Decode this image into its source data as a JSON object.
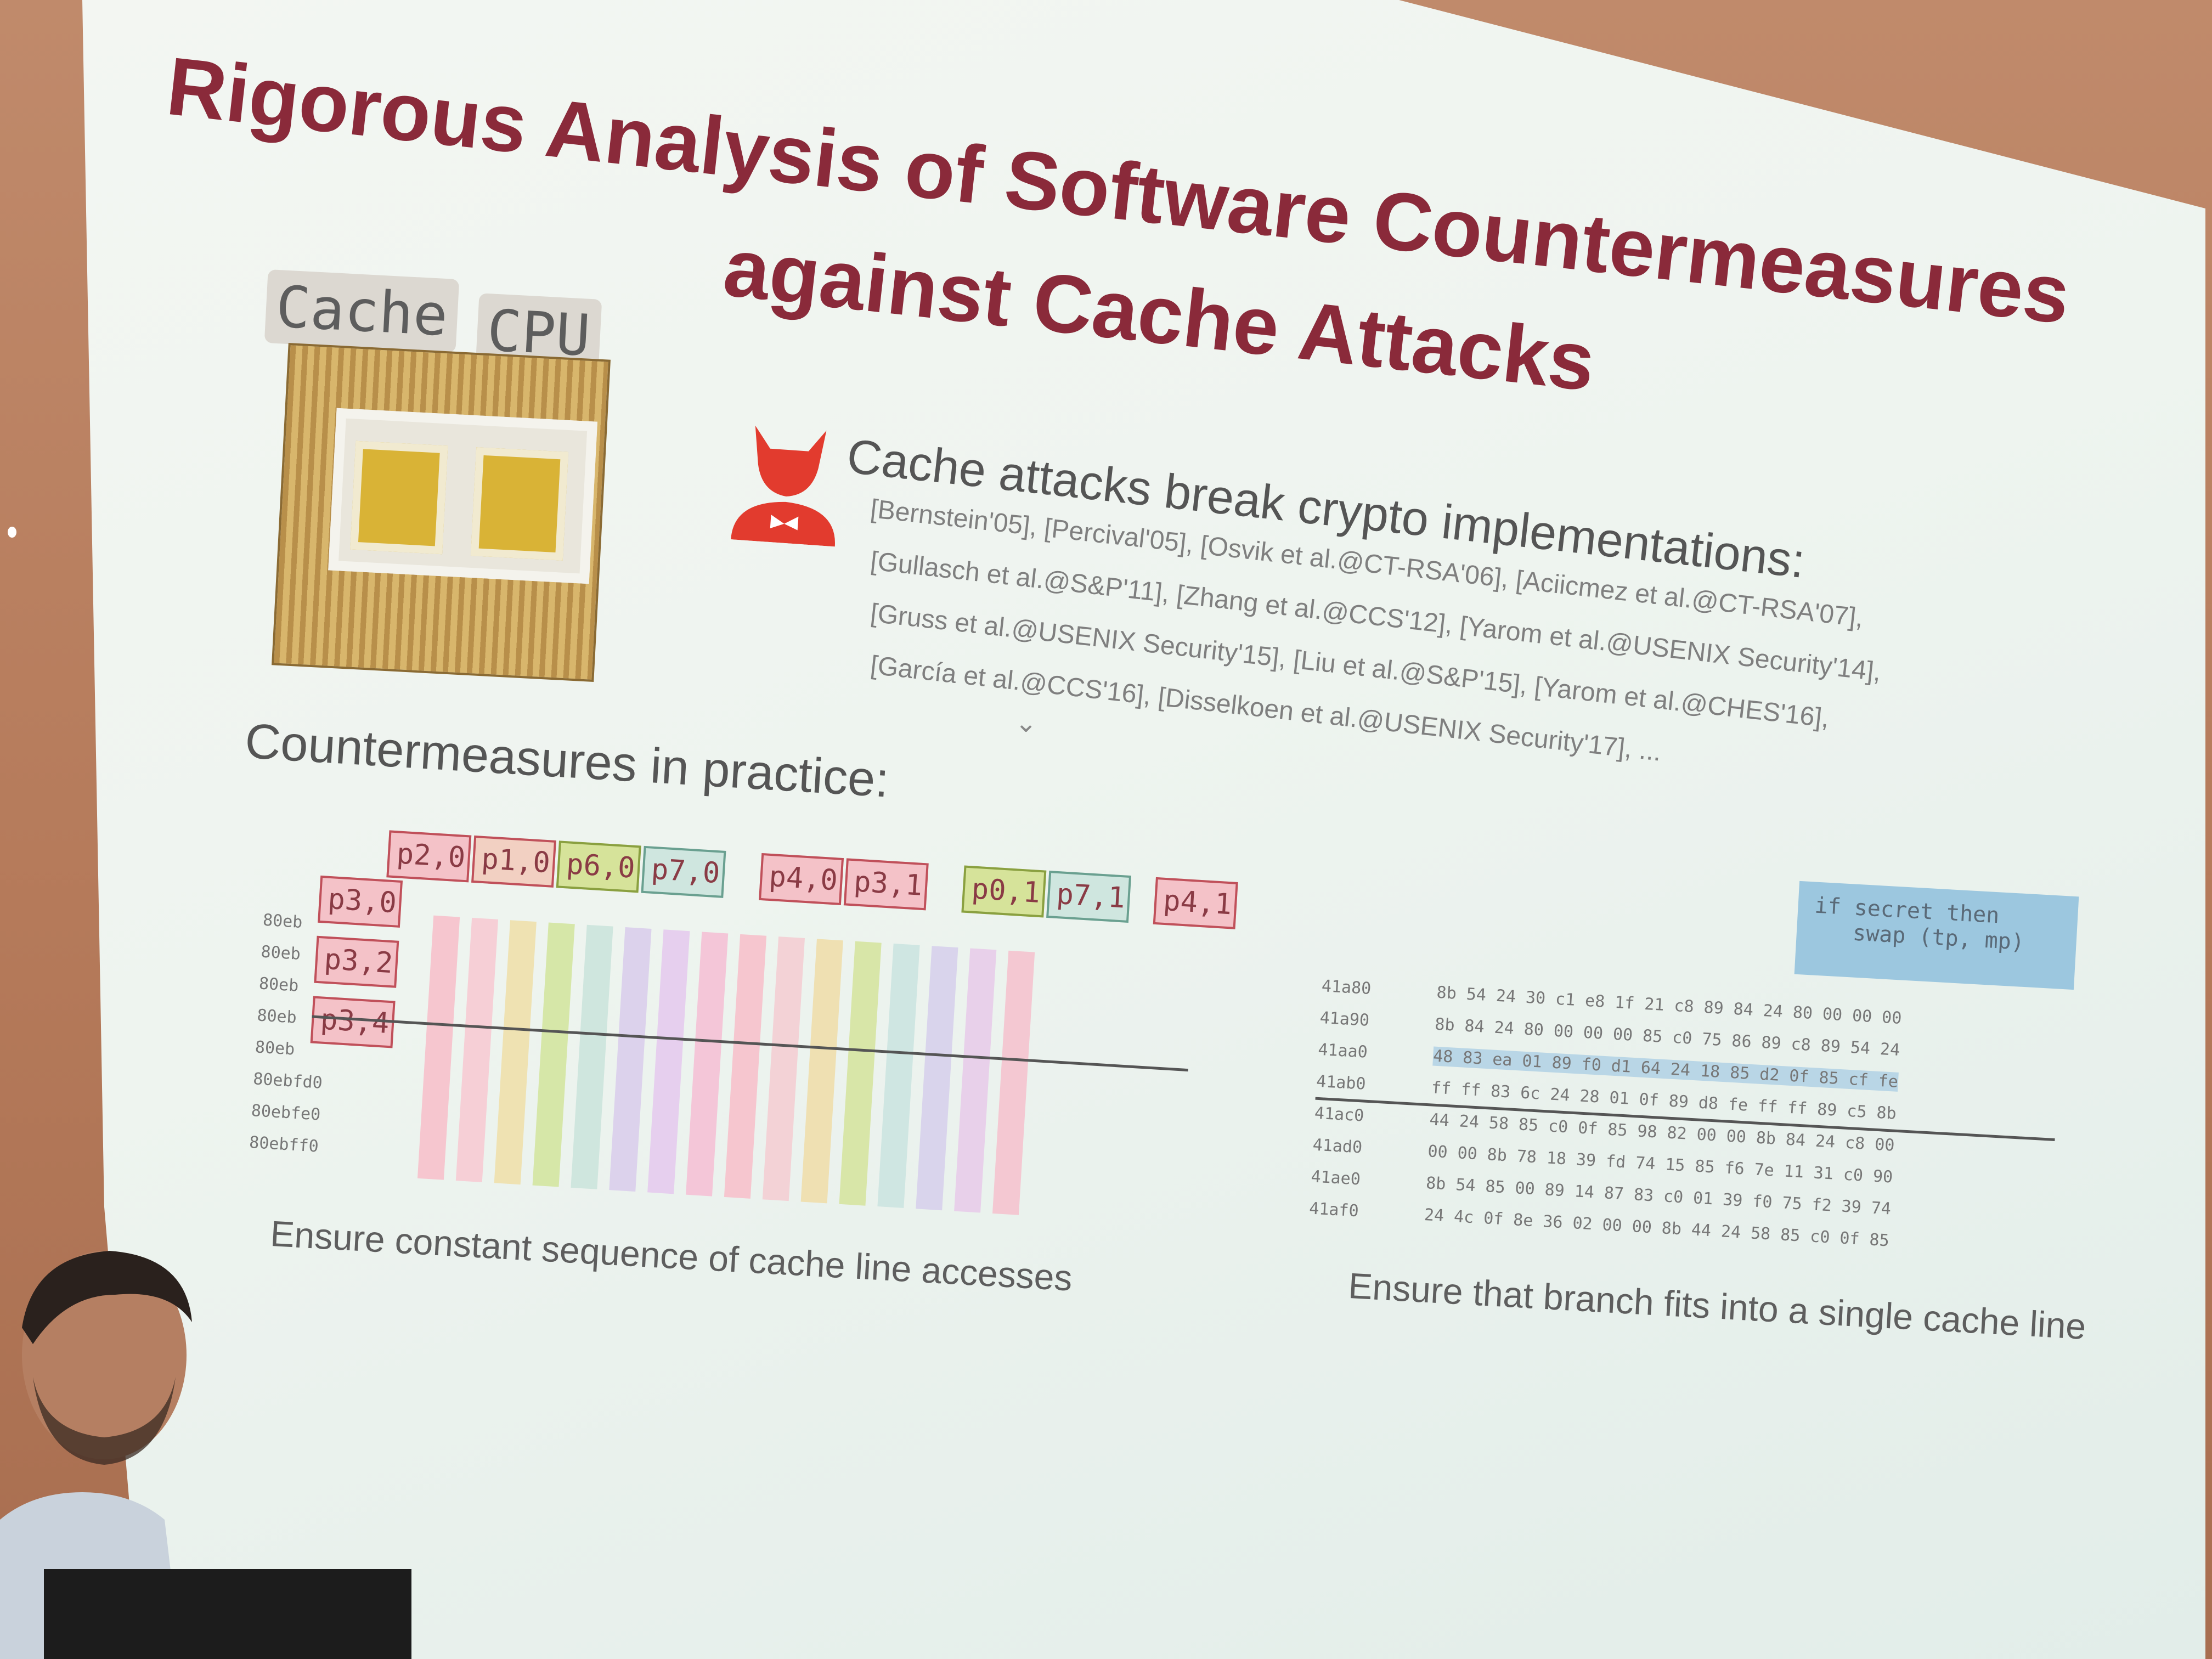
{
  "slide": {
    "title_line1": "Rigorous Analysis of Software Countermeasures",
    "title_line2": "against Cache Attacks",
    "chip_labels": {
      "cache": "Cache",
      "cpu": "CPU"
    },
    "attack_heading": "Cache attacks break crypto implementations:",
    "citations": [
      "[Bernstein'05], [Percival'05], [Osvik et al.@CT-RSA'06], [Aciicmez et al.@CT-RSA'07],",
      "[Gullasch et al.@S&P'11], [Zhang et al.@CCS'12], [Yarom et al.@USENIX Security'14],",
      "[Gruss et al.@USENIX Security'15], [Liu et al.@S&P'15], [Yarom et al.@CHES'16],",
      "[García et al.@CCS'16], [Disselkoen et al.@USENIX Security'17], ..."
    ],
    "countermeasures_heading": "Countermeasures in practice:",
    "left_addresses": [
      "80eb",
      "80eb",
      "80eb",
      "80eb",
      "80eb",
      "80ebfd0",
      "80ebfe0",
      "80ebff0"
    ],
    "tags": [
      "p2,0",
      "p1,0",
      "p6,0",
      "p7,0",
      "p4,0",
      "p3,1",
      "p0,1",
      "p7,1",
      "p4,1",
      "p3,0",
      "p3,2",
      "p3,4"
    ],
    "right_addresses": [
      "41a80",
      "41a90",
      "41aa0",
      "41ab0",
      "41ac0",
      "41ad0",
      "41ae0",
      "41af0"
    ],
    "hex_rows": [
      "8b 54 24 30 c1 e8 1f 21 c8 89 84 24 80 00 00 00",
      "8b 84 24 80 00 00 00 85 c0 75 86 89 c8 89 54 24",
      "48 83 ea 01 89 f0 d1 64 24 18 85 d2 0f 85 cf fe",
      "ff ff 83 6c 24 28 01 0f 89 d8 fe ff ff 89 c5 8b",
      "44 24 58 85 c0 0f 85 98 82 00 00 8b 84 24 c8 00",
      "00 00 8b 78 18 39 fd 74 15 85 f6 7e 11 31 c0 90",
      "8b 54 85 00 89 14 87 83 c0 01 39 f0 75 f2 39 74",
      "24 4c 0f 8e 36 02 00 00 8b 44 24 58 85 c0 0f 85"
    ],
    "code_snippet": "if secret then\n   swap (tp, mp)",
    "caption_left": "Ensure constant sequence of cache line accesses",
    "caption_right": "Ensure that branch fits into a single cache line"
  },
  "colors": {
    "title": "#8a2a3a",
    "devil": "#e23b2e",
    "code_bg": "#9cc7df"
  },
  "icons": [
    "devil-icon",
    "cpu-chip-icon",
    "chevron-down-icon"
  ]
}
